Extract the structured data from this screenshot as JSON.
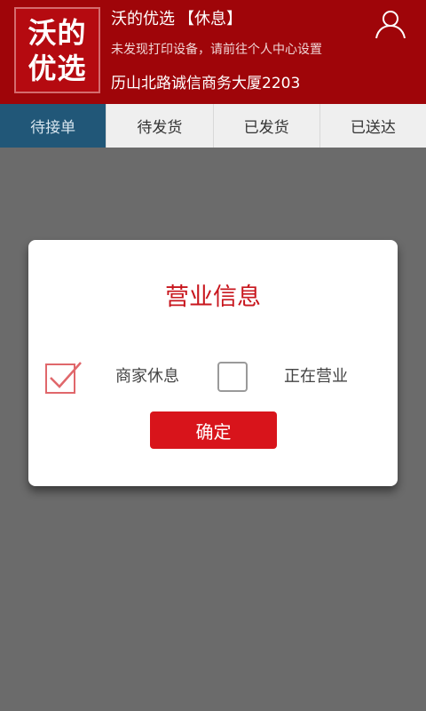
{
  "header": {
    "logo_line1": "沃的",
    "logo_line2": "优选",
    "store_name": "沃的优选",
    "store_status": "【休息】",
    "printer_message": "未发现打印设备，请前往个人中心设置",
    "address": "历山北路诚信商务大厦2203",
    "user_icon": "user-icon"
  },
  "tabs": [
    {
      "label": "待接单",
      "active": true
    },
    {
      "label": "待发货",
      "active": false
    },
    {
      "label": "已发货",
      "active": false
    },
    {
      "label": "已送达",
      "active": false
    }
  ],
  "dialog": {
    "title": "营业信息",
    "options": [
      {
        "label": "商家休息",
        "checked": true
      },
      {
        "label": "正在营业",
        "checked": false
      }
    ],
    "confirm_label": "确定"
  },
  "colors": {
    "header_bg": "#9f0509",
    "active_tab": "#215778",
    "accent_red": "#d8141b",
    "overlay": "#6b6b6b"
  }
}
